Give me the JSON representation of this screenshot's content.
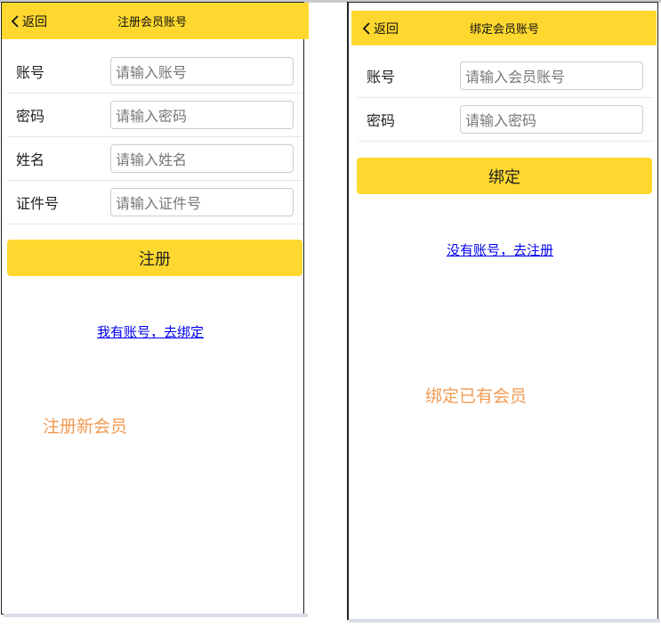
{
  "left_screen": {
    "header": {
      "back_label": "返回",
      "title": "注册会员账号"
    },
    "fields": [
      {
        "label": "账号",
        "placeholder": "请输入账号"
      },
      {
        "label": "密码",
        "placeholder": "请输入密码"
      },
      {
        "label": "姓名",
        "placeholder": "请输入姓名"
      },
      {
        "label": "证件号",
        "placeholder": "请输入证件号"
      }
    ],
    "button_label": "注册",
    "link_label": "我有账号，去绑定",
    "caption": "注册新会员"
  },
  "right_screen": {
    "header": {
      "back_label": "返回",
      "title": "绑定会员账号"
    },
    "fields": [
      {
        "label": "账号",
        "placeholder": "请输入会员账号"
      },
      {
        "label": "密码",
        "placeholder": "请输入密码"
      }
    ],
    "button_label": "绑定",
    "link_label": "没有账号，去注册",
    "caption": "绑定已有会员"
  },
  "colors": {
    "accent": "#fed82f",
    "caption": "#f29a52",
    "link": "#0000ee"
  },
  "icons": {
    "back": "chevron-left-icon"
  }
}
